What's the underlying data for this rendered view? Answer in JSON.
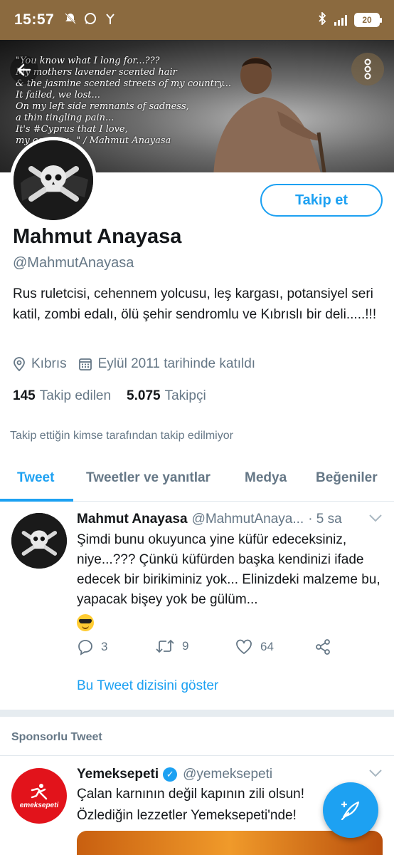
{
  "status_bar": {
    "time": "15:57",
    "battery": "20",
    "icons": [
      "mute-icon",
      "whatsapp-icon",
      "antenna-icon",
      "bluetooth-icon",
      "signal-icon",
      "battery-icon"
    ]
  },
  "header": {
    "quote": "\"You know what I long for...???\nMy mothers lavender scented hair\n& the jasmine scented streets of my country...\nIt failed, we lost...\nOn my left side remnants of sadness,\na thin tingling pain...\nIt's #Cyprus that I love,\nmy country...\"  / Mahmut Anayasa"
  },
  "profile": {
    "follow_label": "Takip et",
    "display_name": "Mahmut Anayasa",
    "handle": "@MahmutAnayasa",
    "bio": "Rus ruletcisi, cehennem yolcusu, leş kargası, potansiyel seri katil, zombi edalı, ölü şehir sendromlu ve Kıbrıslı bir deli.....!!!",
    "location": "Kıbrıs",
    "joined": "Eylül 2011 tarihinde katıldı",
    "following_count": "145",
    "following_label": "Takip edilen",
    "followers_count": "5.075",
    "followers_label": "Takipçi",
    "not_followed_text": "Takip ettiğin kimse tarafından takip edilmiyor"
  },
  "tabs": [
    {
      "label": "Tweet",
      "active": true
    },
    {
      "label": "Tweetler ve yanıtlar",
      "active": false
    },
    {
      "label": "Medya",
      "active": false
    },
    {
      "label": "Beğeniler",
      "active": false
    }
  ],
  "tweet": {
    "name": "Mahmut Anayasa",
    "handle": "@MahmutAnaya...",
    "time": "· 5 sa",
    "text": "Şimdi bunu okuyunca yine küfür edeceksiniz, niye...??? Çünkü küfürden başka kendinizi ifade edecek bir birikiminiz yok... Elinizdeki malzeme bu, yapacak bişey yok be gülüm...",
    "emoji": "cool-sunglasses-emoji",
    "replies": "3",
    "retweets": "9",
    "likes": "64",
    "show_thread": "Bu Tweet dizisini göster"
  },
  "sponsored": {
    "label": "Sponsorlu Tweet",
    "name": "Yemeksepeti",
    "handle": "@yemeksepeti",
    "avatar_label": "emeksepeti",
    "text_line1": "Çalan karnının değil kapının zili olsun!",
    "text_line2": "Özlediğin lezzetler Yemeksepeti'nde!"
  },
  "colors": {
    "accent": "#1da1f2",
    "status_bar": "#8b6a3f",
    "muted_text": "#657786",
    "brand_red": "#e2131b"
  }
}
